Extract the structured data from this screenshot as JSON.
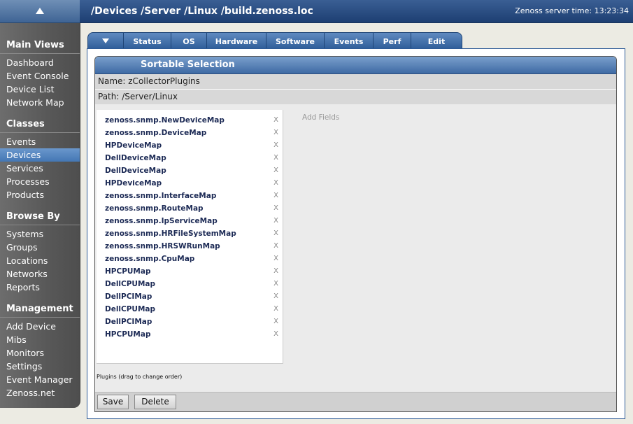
{
  "sidebar": {
    "sections": [
      {
        "title": "Main Views",
        "items": [
          {
            "label": "Dashboard"
          },
          {
            "label": "Event Console"
          },
          {
            "label": "Device List"
          },
          {
            "label": "Network Map"
          }
        ]
      },
      {
        "title": "Classes",
        "items": [
          {
            "label": "Events"
          },
          {
            "label": "Devices",
            "selected": true
          },
          {
            "label": "Services"
          },
          {
            "label": "Processes"
          },
          {
            "label": "Products"
          }
        ]
      },
      {
        "title": "Browse By",
        "items": [
          {
            "label": "Systems"
          },
          {
            "label": "Groups"
          },
          {
            "label": "Locations"
          },
          {
            "label": "Networks"
          },
          {
            "label": "Reports"
          }
        ]
      },
      {
        "title": "Management",
        "items": [
          {
            "label": "Add Device"
          },
          {
            "label": "Mibs"
          },
          {
            "label": "Monitors"
          },
          {
            "label": "Settings"
          },
          {
            "label": "Event Manager"
          },
          {
            "label": "Zenoss.net"
          }
        ]
      }
    ]
  },
  "header": {
    "breadcrumb": "/Devices /Server /Linux /build.zenoss.loc",
    "server_time": "Zenoss server time: 13:23:34"
  },
  "tabs": [
    "Status",
    "OS",
    "Hardware",
    "Software",
    "Events",
    "Perf",
    "Edit"
  ],
  "dialog": {
    "title": "Sortable Selection",
    "name": "Name: zCollectorPlugins",
    "path": "Path: /Server/Linux",
    "add_fields": "Add Fields",
    "plugins_note": "Plugins (drag to change order)",
    "remove_glyph": "X",
    "plugins": [
      "zenoss.snmp.NewDeviceMap",
      "zenoss.snmp.DeviceMap",
      "HPDeviceMap",
      "DellDeviceMap",
      "DellDeviceMap",
      "HPDeviceMap",
      "zenoss.snmp.InterfaceMap",
      "zenoss.snmp.RouteMap",
      "zenoss.snmp.IpServiceMap",
      "zenoss.snmp.HRFileSystemMap",
      "zenoss.snmp.HRSWRunMap",
      "zenoss.snmp.CpuMap",
      "HPCPUMap",
      "DellCPUMap",
      "DellPCIMap",
      "DellCPUMap",
      "DellPCIMap",
      "HPCPUMap"
    ],
    "buttons": {
      "save": "Save",
      "delete": "Delete"
    }
  },
  "colors": {
    "header_bg": "#1d3f72",
    "tab_bg": "#2d5b97",
    "selected_nav": "#4477b4",
    "plugin_text": "#1c2a55"
  }
}
